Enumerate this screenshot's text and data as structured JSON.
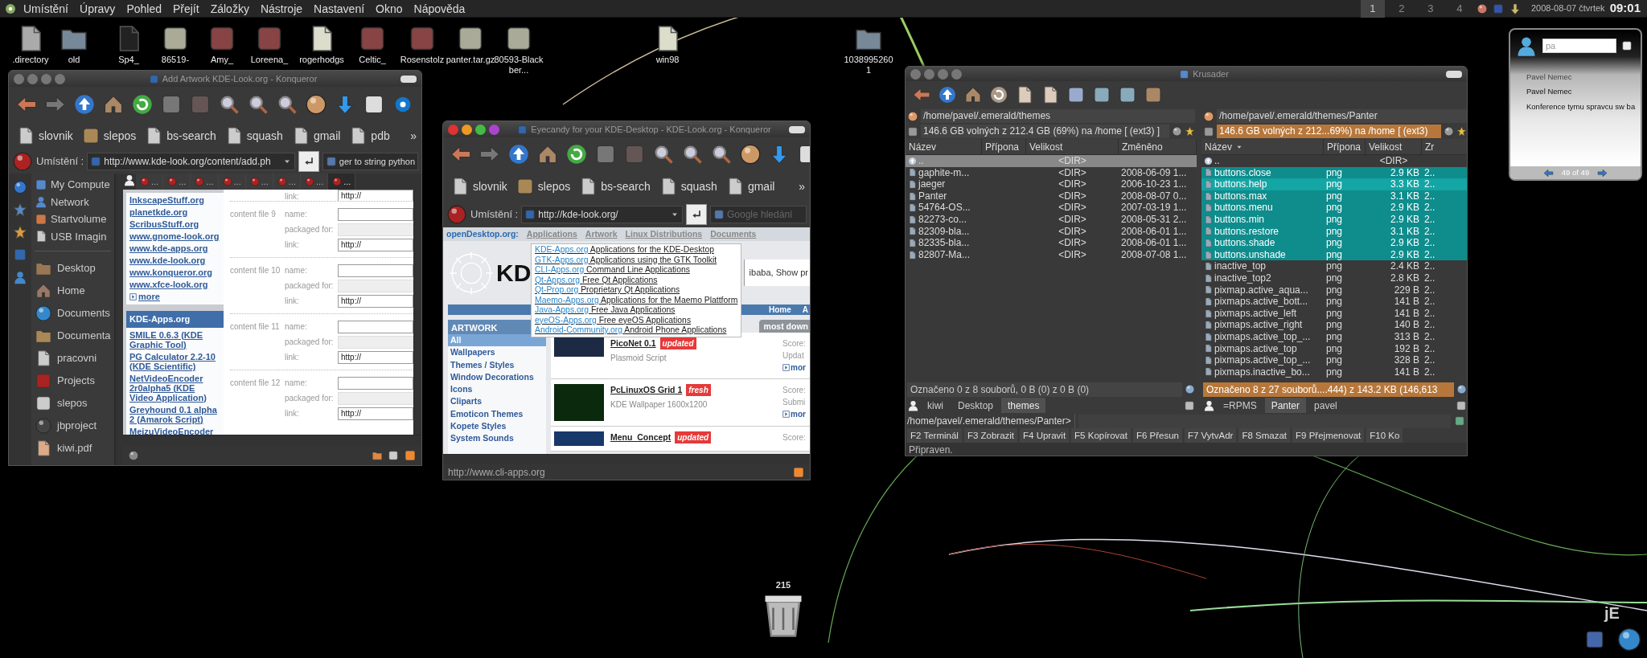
{
  "menubar": {
    "items": [
      "Umístění",
      "Úpravy",
      "Pohled",
      "Přejít",
      "Záložky",
      "Nástroje",
      "Nastavení",
      "Okno",
      "Nápověda"
    ]
  },
  "panel": {
    "desktops": [
      {
        "label": "1",
        "selected": true
      },
      {
        "label": "2",
        "selected": false
      },
      {
        "label": "3",
        "selected": false
      },
      {
        "label": "4",
        "selected": false
      }
    ],
    "date": "2008-08-07 čtvrtek",
    "time": "09:01"
  },
  "desktop_icons": [
    {
      "label": ".directory"
    },
    {
      "label": "old"
    },
    {
      "label": "Sp4_"
    },
    {
      "label": "86519-"
    },
    {
      "label": "Amy_"
    },
    {
      "label": "Loreena_"
    },
    {
      "label": "rogerhodgs"
    },
    {
      "label": "Celtic_"
    },
    {
      "label": "Rosenstolz"
    },
    {
      "label": "panter.tar.gz"
    },
    {
      "label": "80593-Blackber..."
    },
    {
      "label": "win98"
    },
    {
      "label": "10389952601"
    }
  ],
  "konqueror_windows": [
    {
      "kind": "add_artwork",
      "title": "Add Artwork KDE-Look.org - Konqueror",
      "bookmarks": [
        "slovnik",
        "slepos",
        "bs-search",
        "squash",
        "gmail",
        "pdb"
      ],
      "bookmarks_more": "»",
      "location_label": "Umístění :",
      "url": "http://www.kde-look.org/content/add.ph",
      "search": {
        "value": "ger to string python"
      },
      "tabs": [
        {
          "label": "...",
          "selected": false
        },
        {
          "label": "...",
          "selected": false
        },
        {
          "label": "...",
          "selected": false
        },
        {
          "label": "...",
          "selected": false
        },
        {
          "label": "...",
          "selected": false
        },
        {
          "label": "...",
          "selected": false
        },
        {
          "label": "...",
          "selected": false
        },
        {
          "label": "...",
          "selected": true
        }
      ],
      "sidebar": {
        "devices": [
          "My Compute",
          "Network",
          "Startvolume",
          "USB Imagin"
        ],
        "places": [
          "Desktop",
          "Home",
          "Documents",
          "Documenta",
          "pracovni",
          "Projects",
          "slepos",
          "jbproject",
          "kiwi.pdf"
        ]
      },
      "page": {
        "links": [
          "InkscapeStuff.org",
          "planetkde.org",
          "ScribusStuff.org",
          "www.gnome-look.org",
          "www.kde-apps.org",
          "www.kde-look.org",
          "www.konqueror.org",
          "www.xfce-look.org"
        ],
        "more": "more",
        "section_title": "KDE-Apps.org",
        "apps": [
          "SMILE 0.6.3 (KDE Graphic Tool)",
          "PG Calculator 2.2-10 (KDE Scientific)",
          "NetVideoEncoder 2r0alpha5 (KDE Video Application)",
          "Greyhound 0.1 alpha 2 (Amarok Script)",
          "MeizuVideoEncoder"
        ],
        "top_field": {
          "label": "link:",
          "value": "http://"
        },
        "groups": [
          {
            "title": "content file 9",
            "fields": [
              {
                "kind": "text",
                "label": "name:"
              },
              {
                "kind": "select",
                "label": "packaged for:"
              },
              {
                "kind": "text",
                "label": "link:",
                "value": "http://"
              }
            ]
          },
          {
            "title": "content file 10",
            "fields": [
              {
                "kind": "text",
                "label": "name:"
              },
              {
                "kind": "select",
                "label": "packaged for:"
              },
              {
                "kind": "text",
                "label": "link:",
                "value": "http://"
              }
            ]
          },
          {
            "title": "content file 11",
            "fields": [
              {
                "kind": "text",
                "label": "name:"
              },
              {
                "kind": "select",
                "label": "packaged for:"
              },
              {
                "kind": "text",
                "label": "link:",
                "value": "http://"
              }
            ]
          },
          {
            "title": "content file 12",
            "fields": [
              {
                "kind": "text",
                "label": "name:"
              },
              {
                "kind": "select",
                "label": "packaged for:"
              },
              {
                "kind": "text",
                "label": "link:",
                "value": "http://"
              }
            ]
          }
        ]
      }
    },
    {
      "kind": "browse",
      "title": "Eyecandy for your KDE-Desktop - KDE-Look.org - Konqueror",
      "bookmarks": [
        "slovnik",
        "slepos",
        "bs-search",
        "squash",
        "gmail"
      ],
      "bookmarks_more": "»",
      "location_label": "Umístění :",
      "url": "http://kde-look.org/",
      "search": {
        "placeholder": "Google hledání"
      },
      "status": "http://www.cli-apps.org",
      "page": {
        "brand": "openDesktop.org:",
        "nav": [
          "Applications",
          "Artwork",
          "Linux Distributions",
          "Documents"
        ],
        "logo_text": "KD",
        "banner_text": "ibaba, Show pr",
        "bar_links": [
          "Home",
          "A"
        ],
        "menu": [
          {
            "site": "KDE-Apps.org",
            "description": "Applications for the KDE-Desktop"
          },
          {
            "site": "GTK-Apps.org",
            "description": "Applications using the GTK Toolkit"
          },
          {
            "site": "CLI-Apps.org",
            "description": "Command Line Applications"
          },
          {
            "site": "Qt-Apps.org",
            "description": "Free Qt Applications"
          },
          {
            "site": "Qt-Prop.org",
            "description": "Proprietary Qt Applications"
          },
          {
            "site": "Maemo-Apps.org",
            "description": "Applications for the Maemo Plattform"
          },
          {
            "site": "Java-Apps.org",
            "description": "Free Java Applications"
          },
          {
            "site": "eyeOS-Apps.org",
            "description": "Free eyeOS Applications"
          },
          {
            "site": "Android-Community.org",
            "description": "Android Phone Applications"
          }
        ],
        "categories_title": "ARTWORK",
        "categories": [
          {
            "label": "All",
            "selected": true
          },
          {
            "label": "Wallpapers",
            "selected": false
          },
          {
            "label": "Themes / Styles",
            "selected": false
          },
          {
            "label": "Window Decorations",
            "selected": false
          },
          {
            "label": "Icons",
            "selected": false
          },
          {
            "label": "Cliparts",
            "selected": false
          },
          {
            "label": "Emoticon Themes",
            "selected": false
          },
          {
            "label": "Kopete Styles",
            "selected": false
          },
          {
            "label": "System Sounds",
            "selected": false
          }
        ],
        "sort_tab": "most down",
        "entries": [
          {
            "title": "PicoNet 0.1",
            "tag": "updated",
            "subtitle": "Plasmoid Script",
            "side": [
              "Score:",
              "Updat"
            ],
            "more": "mor"
          },
          {
            "title": "PcLinuxOS Grid 1",
            "tag": "fresh",
            "subtitle": "KDE Wallpaper 1600x1200",
            "side": [
              "Score:",
              "Submi"
            ],
            "more": "mor"
          },
          {
            "title": "Menu_Concept",
            "tag": "updated",
            "side": [
              "Score:"
            ]
          }
        ]
      }
    }
  ],
  "krusader": {
    "title": "Krusader",
    "panels": [
      {
        "path": "/home/pavel/.emerald/themes",
        "free_space": "146.6 GB volných z 212.4 GB (69%) na /home [ (ext3) ]",
        "active": false,
        "columns": [
          "Název",
          "Přípona",
          "Velikost",
          "Změněno"
        ],
        "rows": [
          {
            "name": "..",
            "size": "<DIR>",
            "selected": false,
            "current": true
          },
          {
            "name": "gaphite-m...",
            "size": "<DIR>",
            "modified": "2008-06-09 1...",
            "selected": false,
            "current": false
          },
          {
            "name": "jaeger",
            "size": "<DIR>",
            "modified": "2006-10-23 1...",
            "selected": false,
            "current": false
          },
          {
            "name": "Panter",
            "size": "<DIR>",
            "modified": "2008-08-07 0...",
            "selected": false,
            "current": false
          },
          {
            "name": "54764-OS...",
            "size": "<DIR>",
            "modified": "2007-03-19 1...",
            "selected": false,
            "current": false
          },
          {
            "name": "82273-co...",
            "size": "<DIR>",
            "modified": "2008-05-31 2...",
            "selected": false,
            "current": false
          },
          {
            "name": "82309-bla...",
            "size": "<DIR>",
            "modified": "2008-06-01 1...",
            "selected": false,
            "current": false
          },
          {
            "name": "82335-bla...",
            "size": "<DIR>",
            "modified": "2008-06-01 1...",
            "selected": false,
            "current": false
          },
          {
            "name": "82807-Ma...",
            "size": "<DIR>",
            "modified": "2008-07-08 1...",
            "selected": false,
            "current": false
          }
        ],
        "status": "Označeno 0 z 8 souborů, 0 B  (0) z 0 B (0)",
        "tabs": [
          {
            "label": "kiwi",
            "selected": false
          },
          {
            "label": "Desktop",
            "selected": false
          },
          {
            "label": "themes",
            "selected": true
          }
        ]
      },
      {
        "path": "/home/pavel/.emerald/themes/Panter",
        "free_space": "146.6 GB volných z 212...69%) na /home [ (ext3)",
        "active": true,
        "columns": [
          "Název",
          "Přípona",
          "Velikost",
          "Zr"
        ],
        "rows": [
          {
            "name": "..",
            "size": "<DIR>",
            "selected": false,
            "current": false
          },
          {
            "name": "buttons.close",
            "ext": "png",
            "size": "2.9 KB",
            "modified": "2..",
            "selected": true,
            "current": false
          },
          {
            "name": "buttons.help",
            "ext": "png",
            "size": "3.3 KB",
            "modified": "2..",
            "selected": true,
            "current": true
          },
          {
            "name": "buttons.max",
            "ext": "png",
            "size": "3.1 KB",
            "modified": "2..",
            "selected": true,
            "current": false
          },
          {
            "name": "buttons.menu",
            "ext": "png",
            "size": "2.9 KB",
            "modified": "2..",
            "selected": true,
            "current": false
          },
          {
            "name": "buttons.min",
            "ext": "png",
            "size": "2.9 KB",
            "modified": "2..",
            "selected": true,
            "current": false
          },
          {
            "name": "buttons.restore",
            "ext": "png",
            "size": "3.1 KB",
            "modified": "2..",
            "selected": true,
            "current": false
          },
          {
            "name": "buttons.shade",
            "ext": "png",
            "size": "2.9 KB",
            "modified": "2..",
            "selected": true,
            "current": false
          },
          {
            "name": "buttons.unshade",
            "ext": "png",
            "size": "2.9 KB",
            "modified": "2..",
            "selected": true,
            "current": false
          },
          {
            "name": "inactive_top",
            "ext": "png",
            "size": "2.4 KB",
            "modified": "2..",
            "selected": false,
            "current": false
          },
          {
            "name": "inactive_top2",
            "ext": "png",
            "size": "2.8 KB",
            "modified": "2..",
            "selected": false,
            "current": false
          },
          {
            "name": "pixmap.active_aqua...",
            "ext": "png",
            "size": "229 B",
            "modified": "2..",
            "selected": false,
            "current": false
          },
          {
            "name": "pixmaps.active_bott...",
            "ext": "png",
            "size": "141 B",
            "modified": "2..",
            "selected": false,
            "current": false
          },
          {
            "name": "pixmaps.active_left",
            "ext": "png",
            "size": "141 B",
            "modified": "2..",
            "selected": false,
            "current": false
          },
          {
            "name": "pixmaps.active_right",
            "ext": "png",
            "size": "140 B",
            "modified": "2..",
            "selected": false,
            "current": false
          },
          {
            "name": "pixmaps.active_top_...",
            "ext": "png",
            "size": "313 B",
            "modified": "2..",
            "selected": false,
            "current": false
          },
          {
            "name": "pixmaps.active_top",
            "ext": "png",
            "size": "192 B",
            "modified": "2..",
            "selected": false,
            "current": false
          },
          {
            "name": "pixmaps.active_top_...",
            "ext": "png",
            "size": "328 B",
            "modified": "2..",
            "selected": false,
            "current": false
          },
          {
            "name": "pixmaps.inactive_bo...",
            "ext": "png",
            "size": "141 B",
            "modified": "2..",
            "selected": false,
            "current": false
          }
        ],
        "status": "Označeno 8 z 27 souborů....444) z 143.2 KB (146,613",
        "tabs": [
          {
            "label": "=RPMS",
            "selected": false
          },
          {
            "label": "Panter",
            "selected": true
          },
          {
            "label": "pavel",
            "selected": false
          }
        ]
      }
    ],
    "command_prompt": "/home/pavel/.emerald/themes/Panter>",
    "function_keys": [
      "F2 Terminál",
      "F3 Zobrazit",
      "F4 Upravit",
      "F5 Kopírovat",
      "F6 Přesun",
      "F7 VytvAdr",
      "F8 Smazat",
      "F9 Přejmenovat",
      "F10 Ko"
    ],
    "status": "Připraven."
  },
  "contacts_widget": {
    "search_value": "pa",
    "results": [
      {
        "text": "Pavel Nemec",
        "dimmed": true
      },
      {
        "text": "Pavel Nemec",
        "dimmed": false
      },
      {
        "text": "Konference tymu spravcu sw ba",
        "dimmed": false
      }
    ],
    "pager": "49 of 49"
  },
  "trash": {
    "count": "215"
  },
  "corner_logo": "jE"
}
